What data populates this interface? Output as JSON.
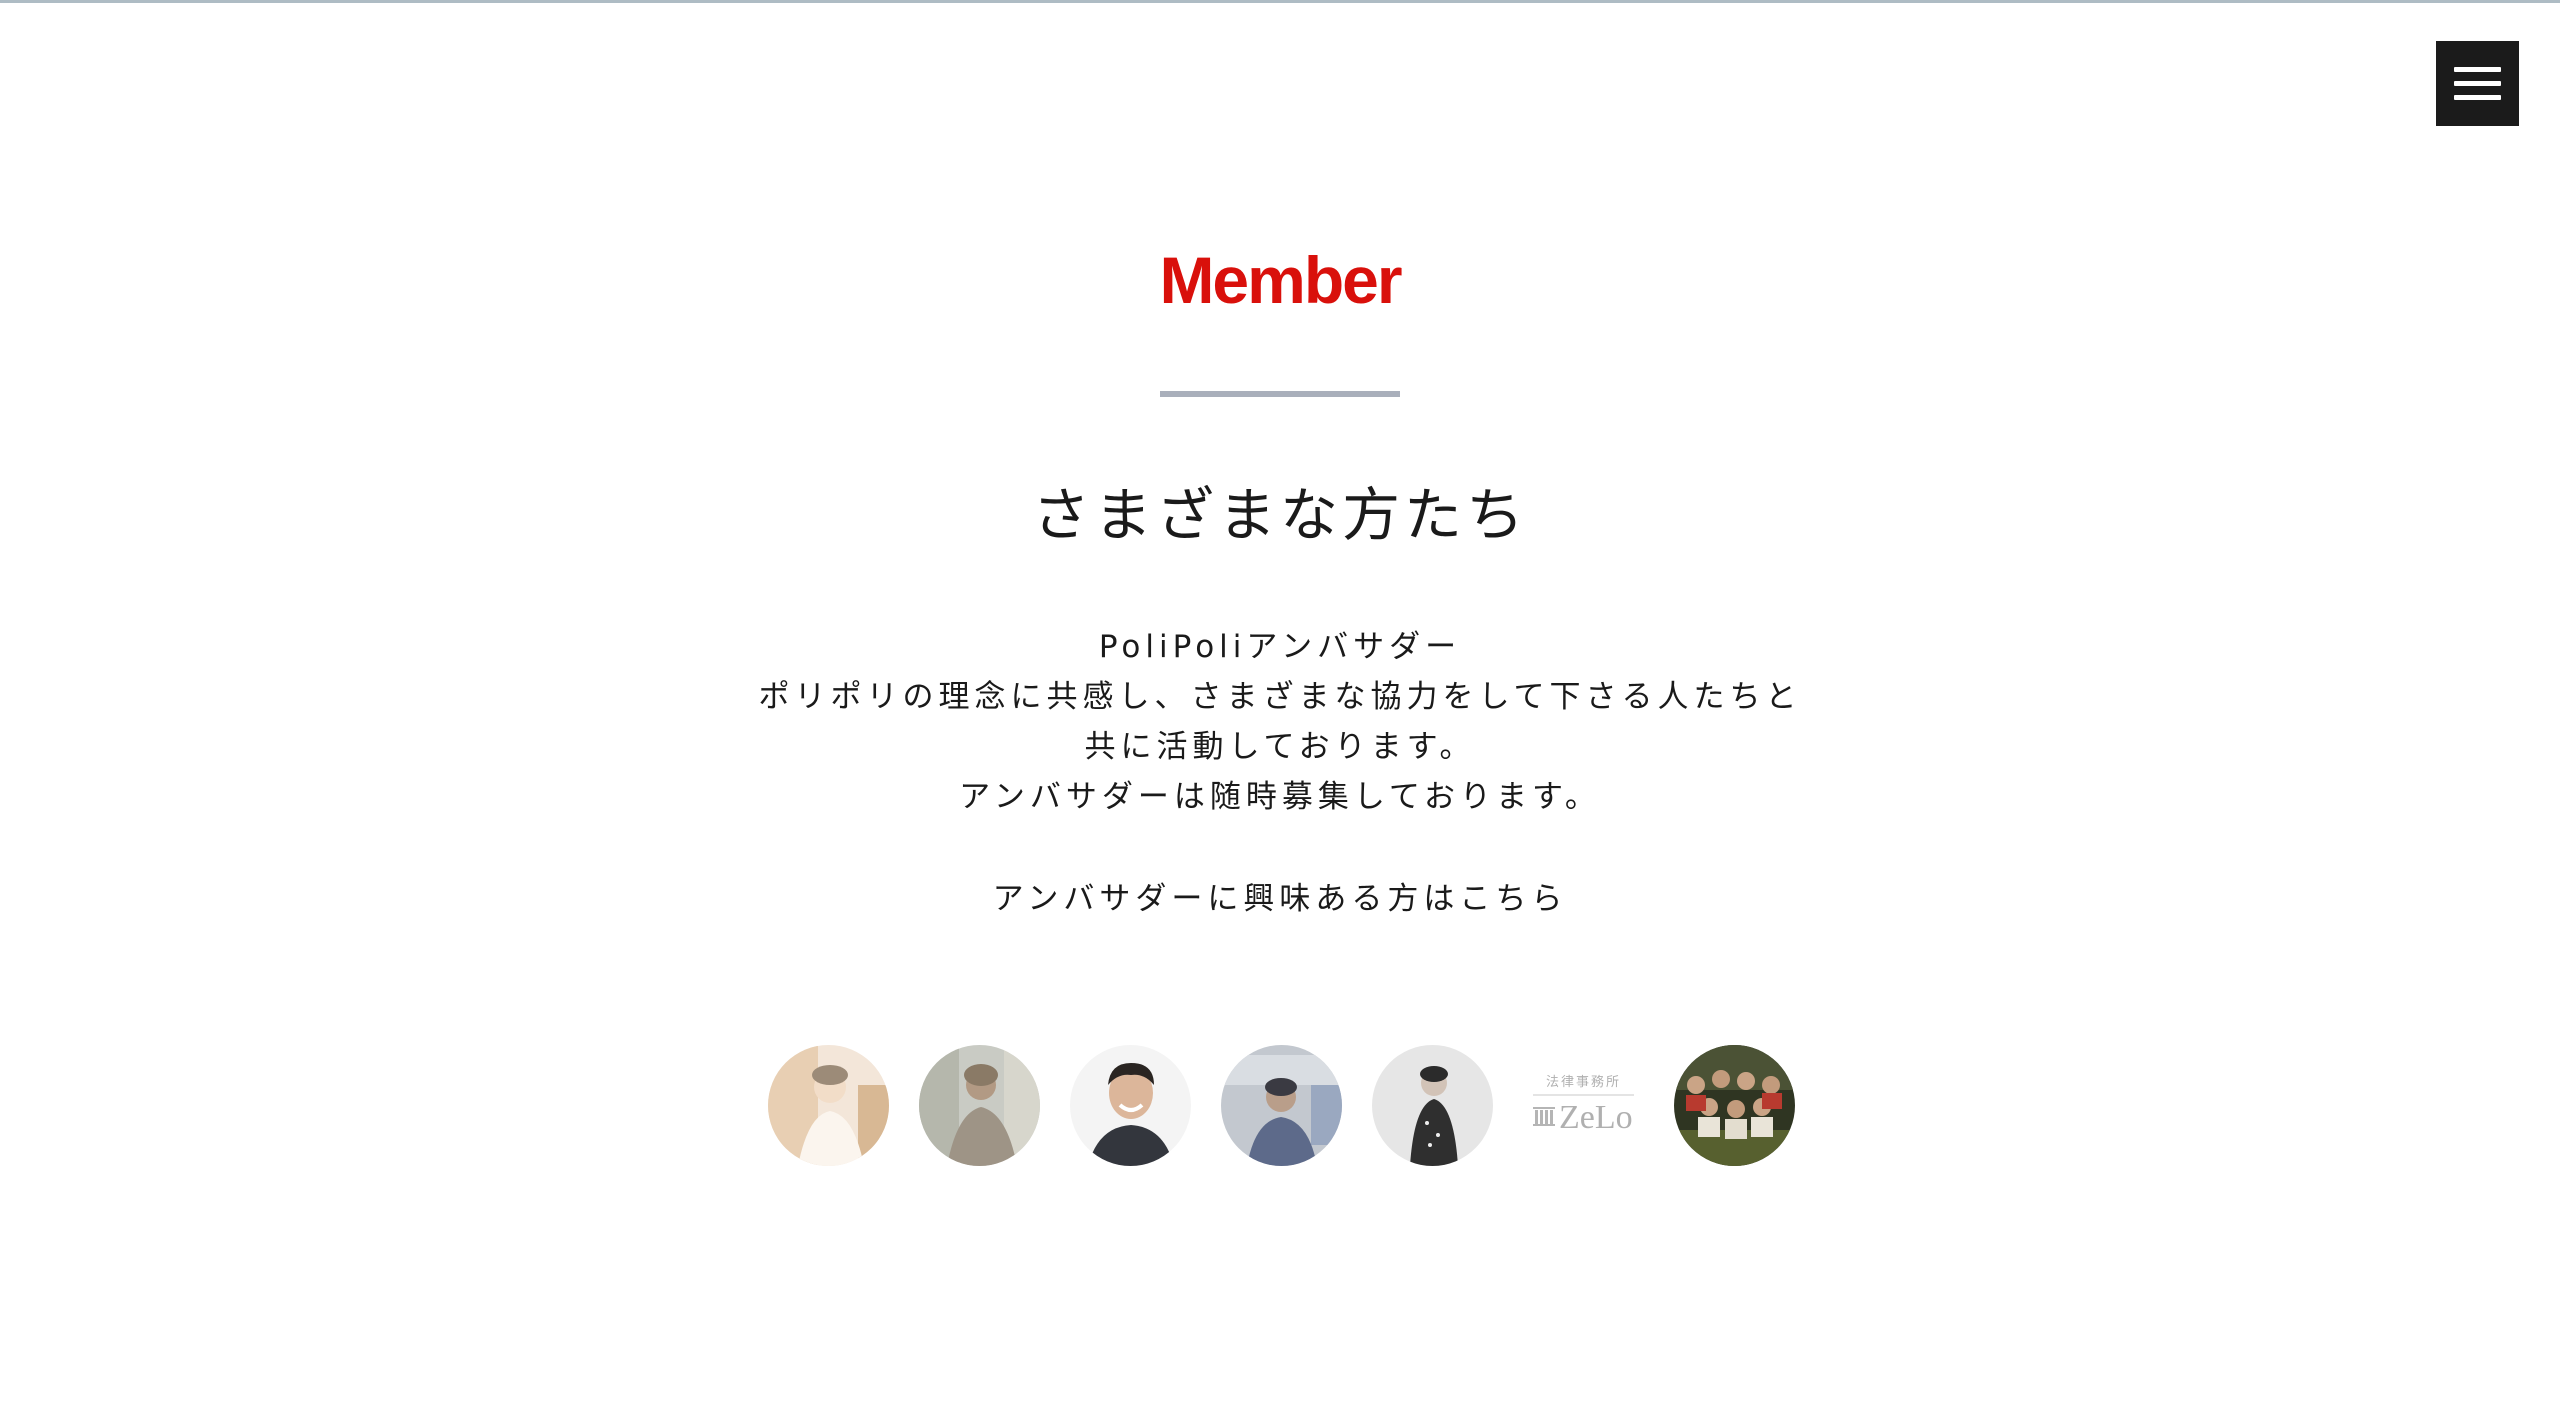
{
  "header": {
    "menu_icon": "hamburger-menu-icon"
  },
  "section": {
    "title": "Member",
    "subtitle": "さまざまな方たち",
    "description_lines": [
      "PoliPoliアンバサダー",
      "ポリポリの理念に共感し、さまざまな協力をして下さる人たちと",
      "共に活動しております。",
      "アンバサダーは随時募集しております。"
    ],
    "cta": "アンバサダーに興味ある方はこちら"
  },
  "members": [
    {
      "kind": "photo"
    },
    {
      "kind": "photo"
    },
    {
      "kind": "photo"
    },
    {
      "kind": "photo"
    },
    {
      "kind": "photo"
    },
    {
      "kind": "logo",
      "logo_small": "法律事務所",
      "logo_main": "ZeLo"
    },
    {
      "kind": "photo"
    }
  ],
  "colors": {
    "accent": "#d9100b",
    "underline": "#a9afbb",
    "menu_bg": "#1b1b1b",
    "text": "#1a1a1a"
  }
}
